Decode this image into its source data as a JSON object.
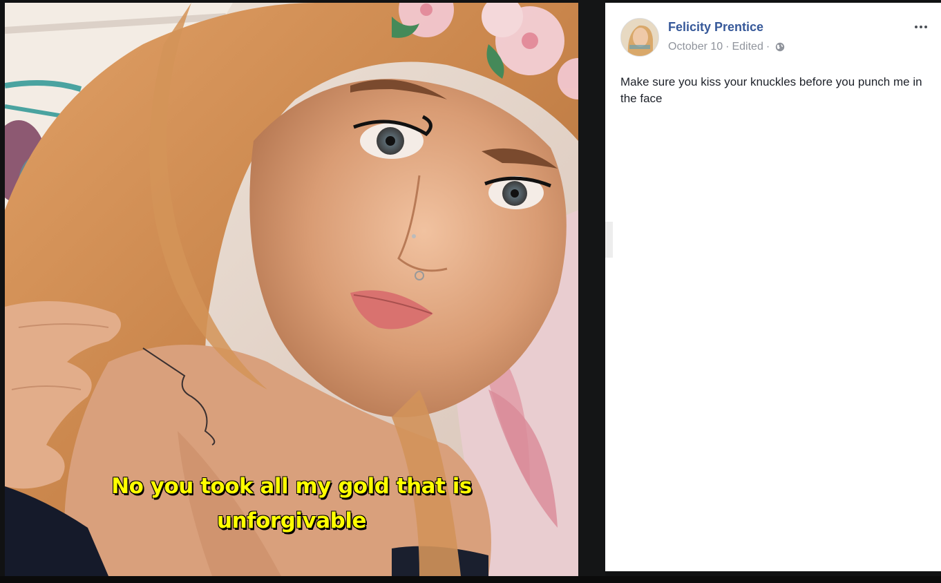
{
  "photo": {
    "caption_line1": "No you took all my gold that is",
    "caption_line2": "unforgivable",
    "caption_color": "#ffff00"
  },
  "post": {
    "author_name": "Felicity Prentice",
    "date": "October 10",
    "separator": "·",
    "edited_label": "Edited",
    "privacy_icon": "globe-icon",
    "more_icon": "more-options-icon",
    "text": "Make sure you kiss your knuckles before you punch me in the face"
  },
  "colors": {
    "author_link": "#365899",
    "meta_text": "#90949c",
    "body_text": "#1d2129",
    "panel_bg": "#ffffff",
    "backdrop": "#111213"
  }
}
